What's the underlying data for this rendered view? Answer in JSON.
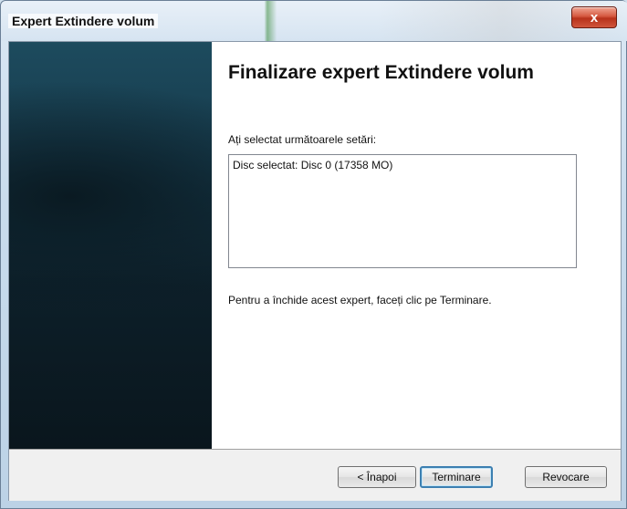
{
  "window": {
    "title": "Expert Extindere volum",
    "close_label": "x"
  },
  "page": {
    "heading": "Finalizare expert Extindere volum",
    "settings_label": "Ați selectat următoarele setări:",
    "settings_lines": [
      "Disc selectat: Disc 0 (17358 MO)"
    ],
    "finish_instruction": "Pentru a închide acest expert, faceți clic pe Terminare."
  },
  "buttons": {
    "back": "< Înapoi",
    "finish": "Terminare",
    "cancel": "Revocare"
  },
  "colors": {
    "close_button": "#c8442b",
    "default_button_border": "#3c7fb1",
    "side_panel": "#163a4b"
  }
}
